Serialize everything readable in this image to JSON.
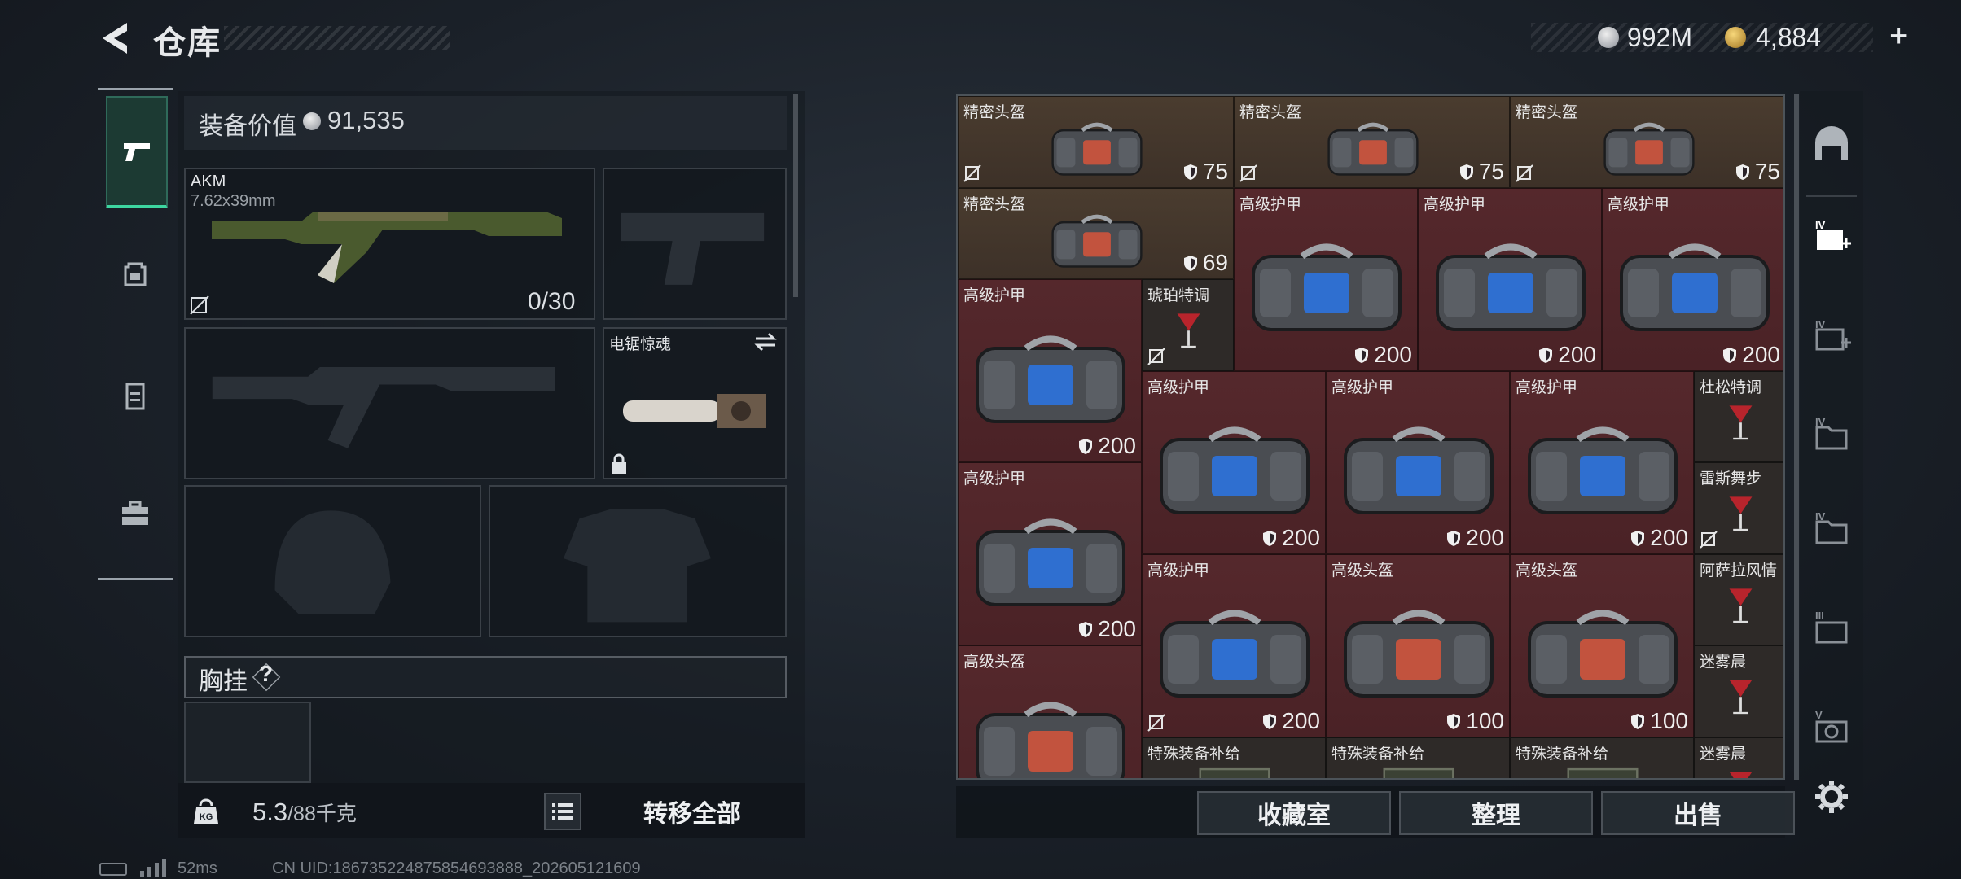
{
  "header": {
    "title": "仓库",
    "currency_silver": "992M",
    "currency_gold": "4,884"
  },
  "equipment": {
    "value_label": "装备价值",
    "value": "91,535",
    "primary": {
      "name": "AKM",
      "caliber": "7.62x39mm",
      "ammo": "0/30"
    },
    "melee": {
      "name": "电锯惊魂"
    },
    "chest_rig_label": "胸挂",
    "chest_rig_help": "?",
    "weight": "5.3",
    "weight_max": "/88千克",
    "transfer_all": "转移全部"
  },
  "stash": {
    "items": [
      {
        "name": "精密头盔",
        "value": "75",
        "color": "gold",
        "type": "helmet"
      },
      {
        "name": "精密头盔",
        "value": "75",
        "color": "gold",
        "type": "helmet"
      },
      {
        "name": "精密头盔",
        "value": "75",
        "color": "gold",
        "type": "helmet"
      },
      {
        "name": "精密头盔",
        "value": "69",
        "color": "gold",
        "type": "helmet"
      },
      {
        "name": "高级护甲",
        "value": "200",
        "color": "red",
        "type": "armor"
      },
      {
        "name": "高级护甲",
        "value": "200",
        "color": "red",
        "type": "armor"
      },
      {
        "name": "高级护甲",
        "value": "200",
        "color": "red",
        "type": "armor"
      },
      {
        "name": "高级护甲",
        "value": "200",
        "color": "red",
        "type": "armor"
      },
      {
        "name": "琥珀特调",
        "value": "",
        "color": "dark",
        "type": "drink"
      },
      {
        "name": "高级护甲",
        "value": "200",
        "color": "red",
        "type": "armor"
      },
      {
        "name": "高级护甲",
        "value": "200",
        "color": "red",
        "type": "armor"
      },
      {
        "name": "高级护甲",
        "value": "200",
        "color": "red",
        "type": "armor"
      },
      {
        "name": "杜松特调",
        "value": "",
        "color": "dark",
        "type": "drink"
      },
      {
        "name": "雷斯舞步",
        "value": "",
        "color": "dark",
        "type": "drink"
      },
      {
        "name": "高级护甲",
        "value": "200",
        "color": "red",
        "type": "armor"
      },
      {
        "name": "高级护甲",
        "value": "200",
        "color": "red",
        "type": "armor"
      },
      {
        "name": "高级头盔",
        "value": "100",
        "color": "red",
        "type": "helmet"
      },
      {
        "name": "高级头盔",
        "value": "100",
        "color": "red",
        "type": "helmet"
      },
      {
        "name": "阿萨拉风情",
        "value": "",
        "color": "dark",
        "type": "drink"
      },
      {
        "name": "高级头盔",
        "value": "",
        "color": "red",
        "type": "helmet"
      },
      {
        "name": "迷雾晨",
        "value": "",
        "color": "dark",
        "type": "drink"
      },
      {
        "name": "特殊装备补给",
        "value": "",
        "color": "dark",
        "type": "crate"
      },
      {
        "name": "特殊装备补给",
        "value": "",
        "color": "dark",
        "type": "crate"
      },
      {
        "name": "特殊装备补给",
        "value": "",
        "color": "dark",
        "type": "crate"
      },
      {
        "name": "迷雾晨",
        "value": "",
        "color": "dark",
        "type": "drink"
      }
    ]
  },
  "actions": {
    "collection": "收藏室",
    "sort": "整理",
    "sell": "出售"
  },
  "status": {
    "ping": "52ms",
    "uid": "CN UID:186735224875854693888_202605121609"
  },
  "icons": {
    "back": "back-chevron-icon",
    "weapon_tab": "pistol-icon",
    "backpack_tab": "backpack-icon",
    "vest_tab": "vest-icon",
    "case_tab": "briefcase-icon",
    "settings": "gear-icon"
  },
  "colors": {
    "accent_green": "#3dd6a0",
    "stash_gold": "#4a3c2f",
    "stash_red": "#55282c"
  }
}
